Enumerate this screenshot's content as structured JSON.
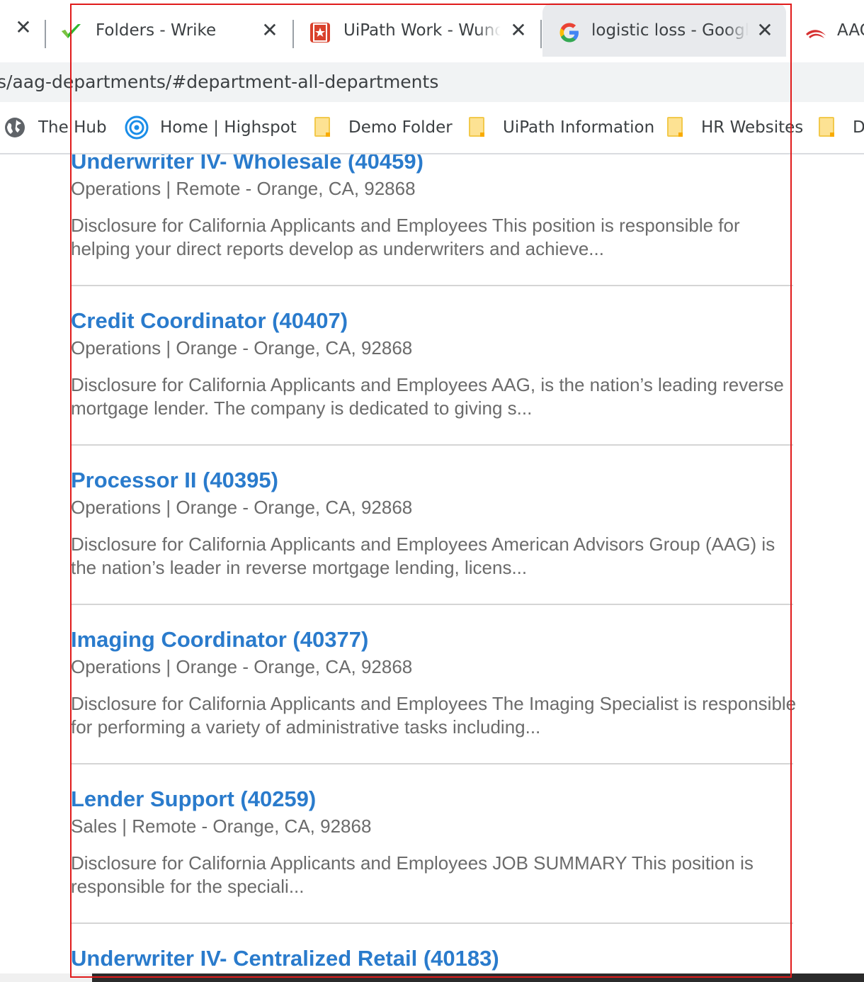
{
  "tabs": [
    {
      "title": "Folders - Wrike",
      "icon": "wrike-check-icon"
    },
    {
      "title": "UiPath Work - Wunderlist",
      "icon": "wunderlist-icon"
    },
    {
      "title": "logistic loss - Google Search",
      "icon": "google-g-icon"
    },
    {
      "title": "AAG",
      "icon": "aag-logo-icon"
    }
  ],
  "address_bar": {
    "url": "s/aag-departments/#department-all-departments"
  },
  "bookmarks": [
    {
      "label": "The Hub",
      "icon": "globe-icon"
    },
    {
      "label": "Home | Highspot",
      "icon": "highspot-icon"
    },
    {
      "label": "Demo Folder",
      "icon": "folder-icon"
    },
    {
      "label": "UiPath Information",
      "icon": "folder-icon"
    },
    {
      "label": "HR Websites",
      "icon": "folder-icon"
    },
    {
      "label": "De",
      "icon": "folder-icon"
    }
  ],
  "jobs": [
    {
      "title": "Underwriter IV- Wholesale (40459)",
      "meta": "Operations | Remote - Orange, CA, 92868",
      "description": "Disclosure for California Applicants and Employees This position is responsible for helping your direct reports develop as underwriters and achieve..."
    },
    {
      "title": "Credit Coordinator (40407)",
      "meta": "Operations | Orange - Orange, CA, 92868",
      "description": "Disclosure for California Applicants and Employees AAG, is the nation’s leading reverse mortgage lender. The company is dedicated to giving s..."
    },
    {
      "title": "Processor II (40395)",
      "meta": "Operations | Orange - Orange, CA, 92868",
      "description": "Disclosure for California Applicants and Employees American Advisors Group (AAG) is the nation’s leader in reverse mortgage lending, licens..."
    },
    {
      "title": "Imaging Coordinator (40377)",
      "meta": "Operations | Orange - Orange, CA, 92868",
      "description": "Disclosure for California Applicants and Employees The Imaging Specialist is responsible for performing a variety of administrative tasks including..."
    },
    {
      "title": "Lender Support (40259)",
      "meta": "Sales | Remote - Orange, CA, 92868",
      "description": "Disclosure for California Applicants and Employees JOB SUMMARY This position is responsible for the speciali..."
    },
    {
      "title": "Underwriter IV- Centralized Retail (40183)",
      "meta": "",
      "description": ""
    }
  ],
  "colors": {
    "job_title": "#2a7bcc",
    "muted_text": "#6b6b6b",
    "highlight": "#e01b1b"
  }
}
